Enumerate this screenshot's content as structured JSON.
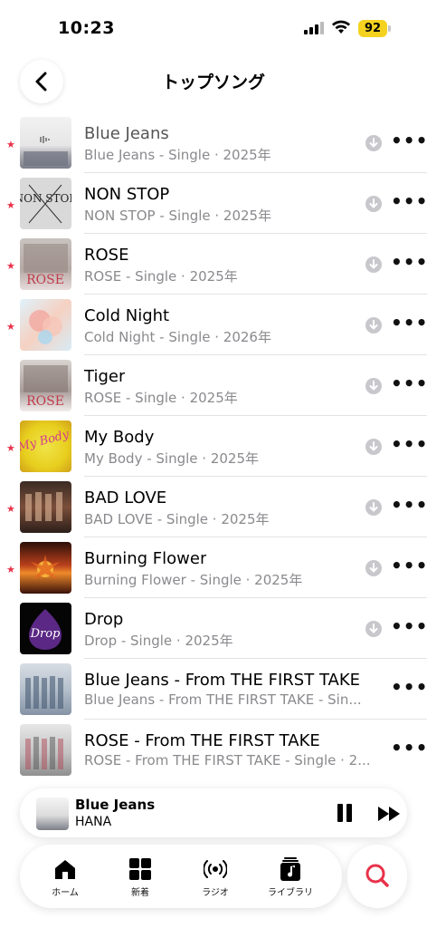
{
  "status_bar": {
    "time": "10:23",
    "battery": "92"
  },
  "header": {
    "title": "トップソング"
  },
  "songs": [
    {
      "title": "Blue Jeans",
      "subtitle": "Blue Jeans - Single · 2025年",
      "starred": true
    },
    {
      "title": "NON STOP",
      "subtitle": "NON STOP - Single · 2025年",
      "starred": true
    },
    {
      "title": "ROSE",
      "subtitle": "ROSE - Single · 2025年",
      "starred": true
    },
    {
      "title": "Cold Night",
      "subtitle": "Cold Night - Single · 2026年",
      "starred": true
    },
    {
      "title": "Tiger",
      "subtitle": "ROSE - Single · 2025年",
      "starred": false
    },
    {
      "title": "My Body",
      "subtitle": "My Body - Single · 2025年",
      "starred": true
    },
    {
      "title": "BAD LOVE",
      "subtitle": "BAD LOVE - Single · 2025年",
      "starred": true
    },
    {
      "title": "Burning Flower",
      "subtitle": "Burning Flower - Single · 2025年",
      "starred": true
    },
    {
      "title": "Drop",
      "subtitle": "Drop - Single · 2025年",
      "starred": false
    },
    {
      "title": "Blue Jeans - From THE FIRST TAKE",
      "subtitle": "Blue Jeans - From THE FIRST TAKE - Sin...",
      "starred": false
    },
    {
      "title": "ROSE - From THE FIRST TAKE",
      "subtitle": "ROSE - From THE FIRST TAKE - Single · 2...",
      "starred": false
    }
  ],
  "art_text": {
    "non_stop": "NON STOP",
    "rose": "ROSE",
    "my_body": "My Body",
    "drop": "Drop"
  },
  "now_playing": {
    "title": "Blue Jeans",
    "artist": "HANA"
  },
  "tabs": [
    {
      "label": "ホーム",
      "icon": "home-icon"
    },
    {
      "label": "新着",
      "icon": "grid-icon"
    },
    {
      "label": "ラジオ",
      "icon": "radio-icon"
    },
    {
      "label": "ライブラリ",
      "icon": "library-icon"
    }
  ],
  "colors": {
    "star": "#e8324a",
    "battery": "#f4d21f",
    "search_accent": "#e8324a",
    "secondary_text": "#8a8a8e"
  }
}
